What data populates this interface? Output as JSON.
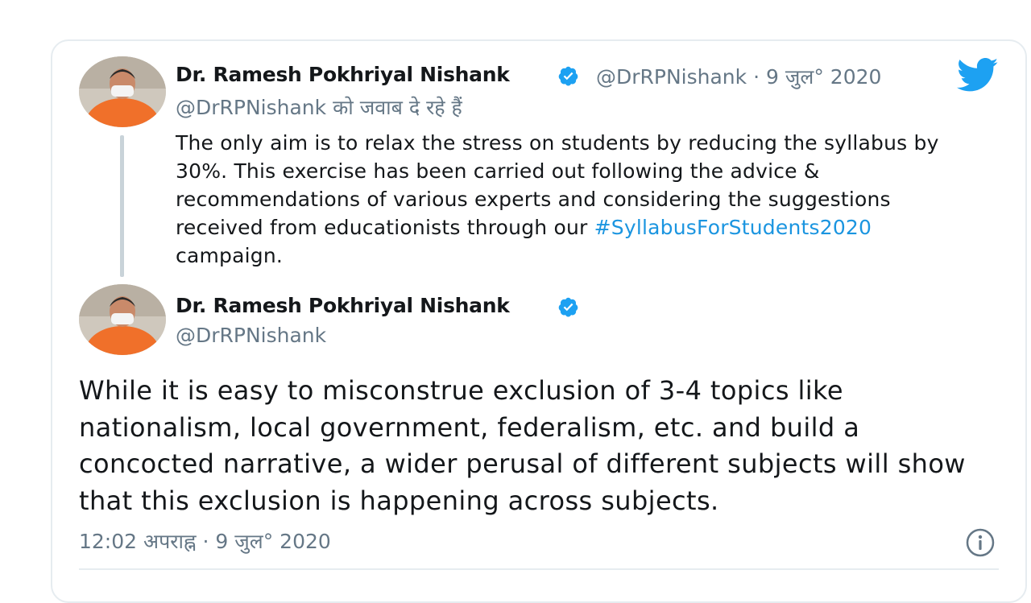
{
  "tweet_reply": {
    "author_name": "Dr. Ramesh Pokhriyal Nishank",
    "handle": "@DrRPNishank",
    "separator": "·",
    "date": "9 जुल° 2020",
    "replying_to": "@DrRPNishank को जवाब दे रहे हैं",
    "text_before_hashtag": "The only aim is to relax the stress on students by reducing the syllabus by 30%. This exercise has been carried out following the advice & recommendations of various experts and considering the suggestions received from educationists through our",
    "hashtag": "#SyllabusForStudents2020",
    "text_after_hashtag": " campaign."
  },
  "main_tweet": {
    "author_name": "Dr. Ramesh Pokhriyal Nishank",
    "handle": "@DrRPNishank",
    "text": "While it is easy to misconstrue exclusion of 3-4 topics like nationalism, local government, federalism, etc. and build a concocted narrative, a wider perusal of different subjects will show that this exclusion is happening across subjects.",
    "timestamp": "12:02 अपराह्न · 9 जुल° 2020"
  },
  "icons": {
    "brand": "twitter-bird-icon",
    "verified": "verified-badge-icon",
    "info": "info-icon"
  },
  "colors": {
    "brand_blue": "#1da1f2",
    "hashtag_blue": "#1b95e0",
    "secondary_text": "#657786",
    "border": "#e6ecf0"
  }
}
